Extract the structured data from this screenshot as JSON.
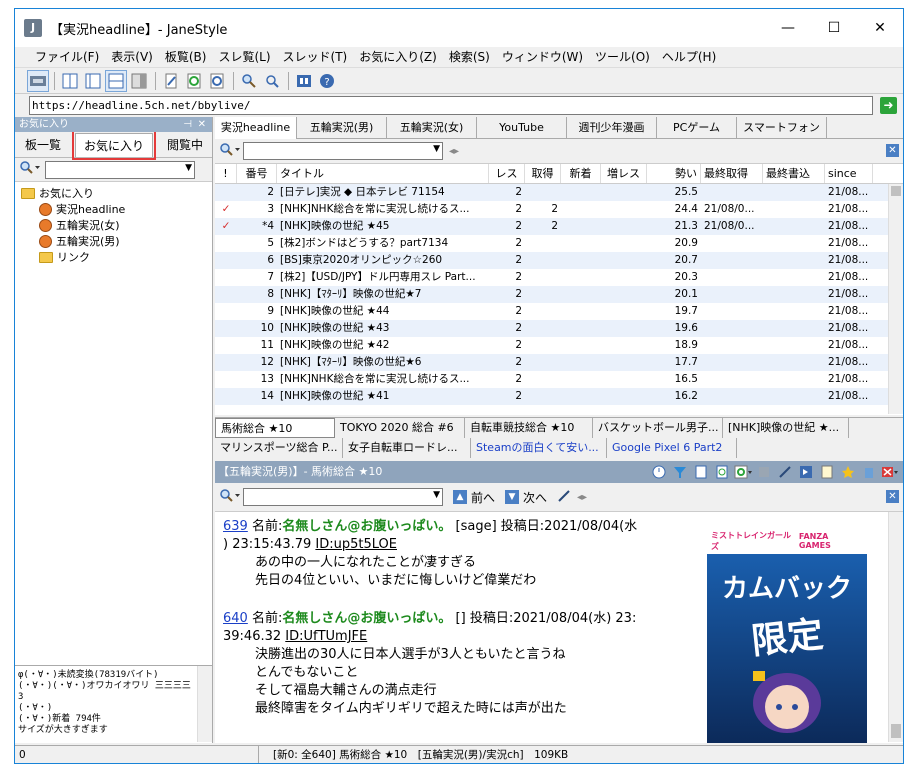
{
  "window": {
    "title": "【実況headline】- JaneStyle",
    "app_icon": "J",
    "minimize": "—",
    "maximize": "☐",
    "close": "✕"
  },
  "menu": [
    "ファイル(F)",
    "表示(V)",
    "板覧(B)",
    "スレ覧(L)",
    "スレッド(T)",
    "お気に入り(Z)",
    "検索(S)",
    "ウィンドウ(W)",
    "ツール(O)",
    "ヘルプ(H)"
  ],
  "address": {
    "url": "https://headline.5ch.net/bbylive/",
    "go": "➜"
  },
  "left_panel": {
    "header": "お気に入り",
    "pin": "⊣",
    "close": "✕",
    "tabs": [
      "板一覧",
      "お気に入り",
      "閲覧中"
    ],
    "tree": [
      {
        "label": "お気に入り",
        "type": "folder",
        "indent": 0
      },
      {
        "label": "実況headline",
        "type": "board",
        "indent": 1
      },
      {
        "label": "五輪実況(女)",
        "type": "board",
        "indent": 1
      },
      {
        "label": "五輪実況(男)",
        "type": "board",
        "indent": 1
      },
      {
        "label": "リンク",
        "type": "folder",
        "indent": 1
      }
    ],
    "log": [
      "φ(・∀・)未読変換(78319バイト)",
      "(・∀・)(・∀・)オワカイオワリ 三三三三",
      "3",
      "(・∀・)",
      "(・∀・)新着 794件",
      "サイズが大きすぎます"
    ]
  },
  "thread_tabs": [
    "実況headline",
    "五輪実況(男)",
    "五輪実況(女)",
    "YouTube",
    "週刊少年漫画",
    "PCゲーム",
    "スマートフォン"
  ],
  "thread_list": {
    "columns": [
      "!",
      "番号",
      "タイトル",
      "レス",
      "取得",
      "新着",
      "増レス",
      "勢い",
      "最終取得",
      "最終書込",
      "since"
    ],
    "rows": [
      {
        "mark": "",
        "no": "2",
        "title": "[日テレ]実況 ◆ 日本テレビ 71154",
        "res": "2",
        "got": "",
        "new": "",
        "inc": "",
        "ikioi": "25.5",
        "last_get": "",
        "last_post": "",
        "since": "21/08..."
      },
      {
        "mark": "✓",
        "no": "3",
        "title": "[NHK]NHK総合を常に実況し続けるス...",
        "res": "2",
        "got": "2",
        "new": "",
        "inc": "",
        "ikioi": "24.4",
        "last_get": "21/08/0...",
        "last_post": "",
        "since": "21/08..."
      },
      {
        "mark": "✓",
        "no": "*4",
        "title": "[NHK]映像の世紀 ★45",
        "res": "2",
        "got": "2",
        "new": "",
        "inc": "",
        "ikioi": "21.3",
        "last_get": "21/08/0...",
        "last_post": "",
        "since": "21/08..."
      },
      {
        "mark": "",
        "no": "5",
        "title": "[株2]ボンドはどうする？part7134",
        "res": "2",
        "got": "",
        "new": "",
        "inc": "",
        "ikioi": "20.9",
        "last_get": "",
        "last_post": "",
        "since": "21/08..."
      },
      {
        "mark": "",
        "no": "6",
        "title": "[BS]東京2020オリンピック☆260",
        "res": "2",
        "got": "",
        "new": "",
        "inc": "",
        "ikioi": "20.7",
        "last_get": "",
        "last_post": "",
        "since": "21/08..."
      },
      {
        "mark": "",
        "no": "7",
        "title": "[株2]【USD/JPY】ドル円専用スレ Part...",
        "res": "2",
        "got": "",
        "new": "",
        "inc": "",
        "ikioi": "20.3",
        "last_get": "",
        "last_post": "",
        "since": "21/08..."
      },
      {
        "mark": "",
        "no": "8",
        "title": "[NHK]【ﾏﾀｰﾘ】映像の世紀★7",
        "res": "2",
        "got": "",
        "new": "",
        "inc": "",
        "ikioi": "20.1",
        "last_get": "",
        "last_post": "",
        "since": "21/08..."
      },
      {
        "mark": "",
        "no": "9",
        "title": "[NHK]映像の世紀 ★44",
        "res": "2",
        "got": "",
        "new": "",
        "inc": "",
        "ikioi": "19.7",
        "last_get": "",
        "last_post": "",
        "since": "21/08..."
      },
      {
        "mark": "",
        "no": "10",
        "title": "[NHK]映像の世紀 ★43",
        "res": "2",
        "got": "",
        "new": "",
        "inc": "",
        "ikioi": "19.6",
        "last_get": "",
        "last_post": "",
        "since": "21/08..."
      },
      {
        "mark": "",
        "no": "11",
        "title": "[NHK]映像の世紀 ★42",
        "res": "2",
        "got": "",
        "new": "",
        "inc": "",
        "ikioi": "18.9",
        "last_get": "",
        "last_post": "",
        "since": "21/08..."
      },
      {
        "mark": "",
        "no": "12",
        "title": "[NHK]【ﾏﾀｰﾘ】映像の世紀★6",
        "res": "2",
        "got": "",
        "new": "",
        "inc": "",
        "ikioi": "17.7",
        "last_get": "",
        "last_post": "",
        "since": "21/08..."
      },
      {
        "mark": "",
        "no": "13",
        "title": "[NHK]NHK総合を常に実況し続けるス...",
        "res": "2",
        "got": "",
        "new": "",
        "inc": "",
        "ikioi": "16.5",
        "last_get": "",
        "last_post": "",
        "since": "21/08..."
      },
      {
        "mark": "",
        "no": "14",
        "title": "[NHK]映像の世紀 ★41",
        "res": "2",
        "got": "",
        "new": "",
        "inc": "",
        "ikioi": "16.2",
        "last_get": "",
        "last_post": "",
        "since": "21/08..."
      }
    ]
  },
  "res_tabs": {
    "row1": [
      "馬術総合 ★10",
      "TOKYO 2020 総合 #6",
      "自転車競技総合 ★10",
      "バスケットボール男子...",
      "[NHK]映像の世紀 ★..."
    ],
    "row2": [
      "マリンスポーツ総合 P...",
      "女子自転車ロードレ...",
      "Steamの面白くて安い...",
      "Google Pixel 6 Part2"
    ]
  },
  "viewer": {
    "title": "【五輪実況(男)】- 馬術総合 ★10",
    "prev": "前へ",
    "next": "次へ",
    "posts": [
      {
        "num": "639",
        "name_label": "名前:",
        "name": "名無しさん@お腹いっぱい。",
        "mail": "[sage]",
        "date": "投稿日:2021/08/04(水",
        "date2": ") 23:15:43.79",
        "id": "ID:up5t5LOE",
        "lines": [
          "あの中の一人になれたことが凄すぎる",
          "先日の4位といい、いまだに悔しいけど偉業だわ"
        ]
      },
      {
        "num": "640",
        "name_label": "名前:",
        "name": "名無しさん@お腹いっぱい。",
        "mail": "[]",
        "date": "投稿日:2021/08/04(水) 23:",
        "date2": "39:46.32",
        "id": "ID:UfTUmJFE",
        "lines": [
          "決勝進出の30人に日本人選手が3人ともいたと言うね",
          "とんでもないこと",
          "そして福島大輔さんの満点走行",
          "最終障害をタイム内ギリギリで超えた時には声が出た"
        ]
      }
    ],
    "ad": {
      "top": "ミストトレインガールズ",
      "brand": "FANZA GAMES",
      "line1": "カムバック",
      "line2": "限定"
    }
  },
  "status": {
    "left": "0",
    "main": "[新0: 全640] 馬術総合 ★10　[五輪実況(男)/実況ch]　109KB"
  }
}
